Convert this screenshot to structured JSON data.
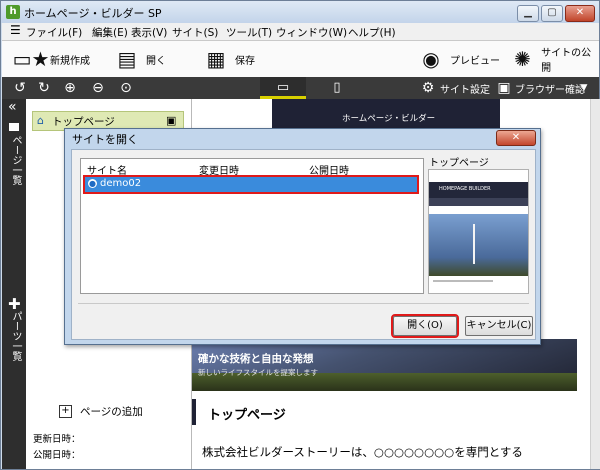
{
  "window": {
    "title": "ホームページ・ビルダー SP",
    "app_icon": "h",
    "controls": [
      "minimize-icon",
      "maximize-icon",
      "close-icon"
    ]
  },
  "menu": [
    "ファイル(F)",
    "編集(E)",
    "表示(V)",
    "サイト(S)",
    "ツール(T)",
    "ウィンドウ(W)",
    "ヘルプ(H)"
  ],
  "toolbar": {
    "new_label": "新規作成",
    "open_label": "開く",
    "save_label": "保存",
    "preview_label": "プレビュー",
    "publish_label": "サイトの公開"
  },
  "toolbar2": {
    "site_settings_label": "サイト設定",
    "browser_check_label": "ブラウザー確認"
  },
  "left_rail": {
    "collapse_glyph": "«",
    "page_list_label": "ページ一覧",
    "parts_list_label": "パーツ一覧"
  },
  "side_panel": {
    "page_item_label": "トップページ",
    "add_page_label": "ページの追加",
    "updated_label": "更新日時：",
    "published_label": "公開日時："
  },
  "content": {
    "site_header": "ホームページ・ビルダー",
    "hero_title": "確かな技術と自由な発想",
    "hero_subtitle": "新しいライフスタイルを提案します",
    "section_heading": "トップページ",
    "body_text": "株式会社ビルダーストーリーは、○○○○○○○○を専門とする"
  },
  "dialog": {
    "title": "サイトを開く",
    "columns": [
      "サイト名",
      "変更日時",
      "公開日時"
    ],
    "sites": [
      {
        "name": "demo02",
        "modified": "",
        "published": ""
      }
    ],
    "preview_label": "トップページ",
    "preview_site_title": "HOMEPAGE BUILDER",
    "open_button": "開く(O)",
    "cancel_button": "キャンセル(C)"
  },
  "colors": {
    "selection": "#3a8bdc",
    "highlight_outline": "#e01a1a",
    "toolbar_dark": "#3a3a3a",
    "device_tab_accent": "#d8d000"
  }
}
